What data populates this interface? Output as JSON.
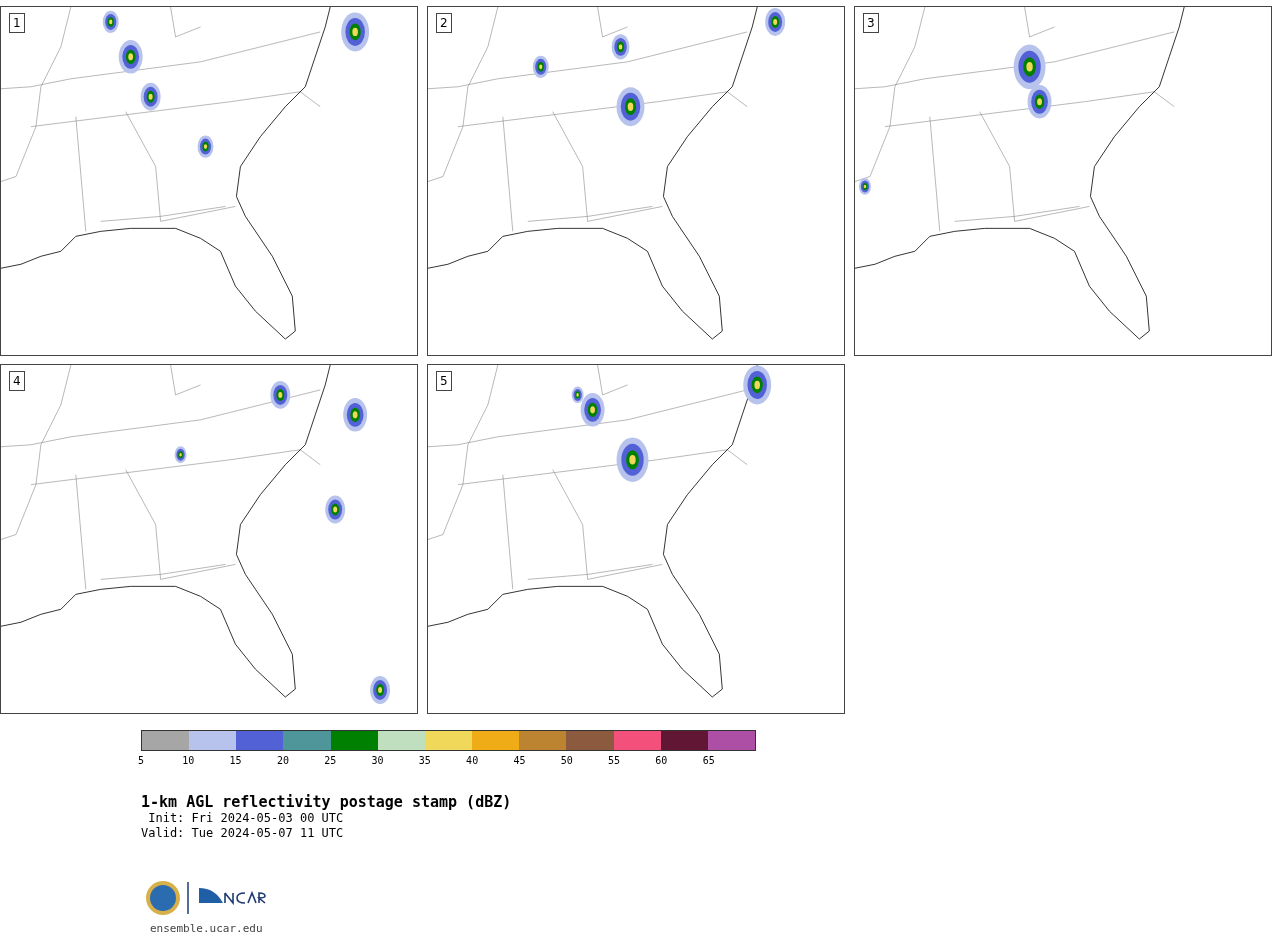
{
  "panels": [
    {
      "label": "1"
    },
    {
      "label": "2"
    },
    {
      "label": "3"
    },
    {
      "label": "4"
    },
    {
      "label": "5"
    }
  ],
  "colorbar": {
    "bins": [
      {
        "color": "#a6a6a6"
      },
      {
        "color": "#b7c3ec"
      },
      {
        "color": "#5261d6"
      },
      {
        "color": "#4f969b"
      },
      {
        "color": "#008000"
      },
      {
        "color": "#bfdfbf"
      },
      {
        "color": "#f0d85a"
      },
      {
        "color": "#f0ac16"
      },
      {
        "color": "#bc8430"
      },
      {
        "color": "#8c5a3e"
      },
      {
        "color": "#f4507c"
      },
      {
        "color": "#611733"
      },
      {
        "color": "#ae4fa6"
      }
    ],
    "ticks": [
      "5",
      "10",
      "15",
      "20",
      "25",
      "30",
      "35",
      "40",
      "45",
      "50",
      "55",
      "60",
      "65"
    ]
  },
  "title": "1-km AGL reflectivity postage stamp (dBZ)",
  "init": " Init: Fri 2024-05-03 00 UTC",
  "valid": "Valid: Tue 2024-05-07 11 UTC",
  "footer_url": "ensemble.ucar.edu"
}
